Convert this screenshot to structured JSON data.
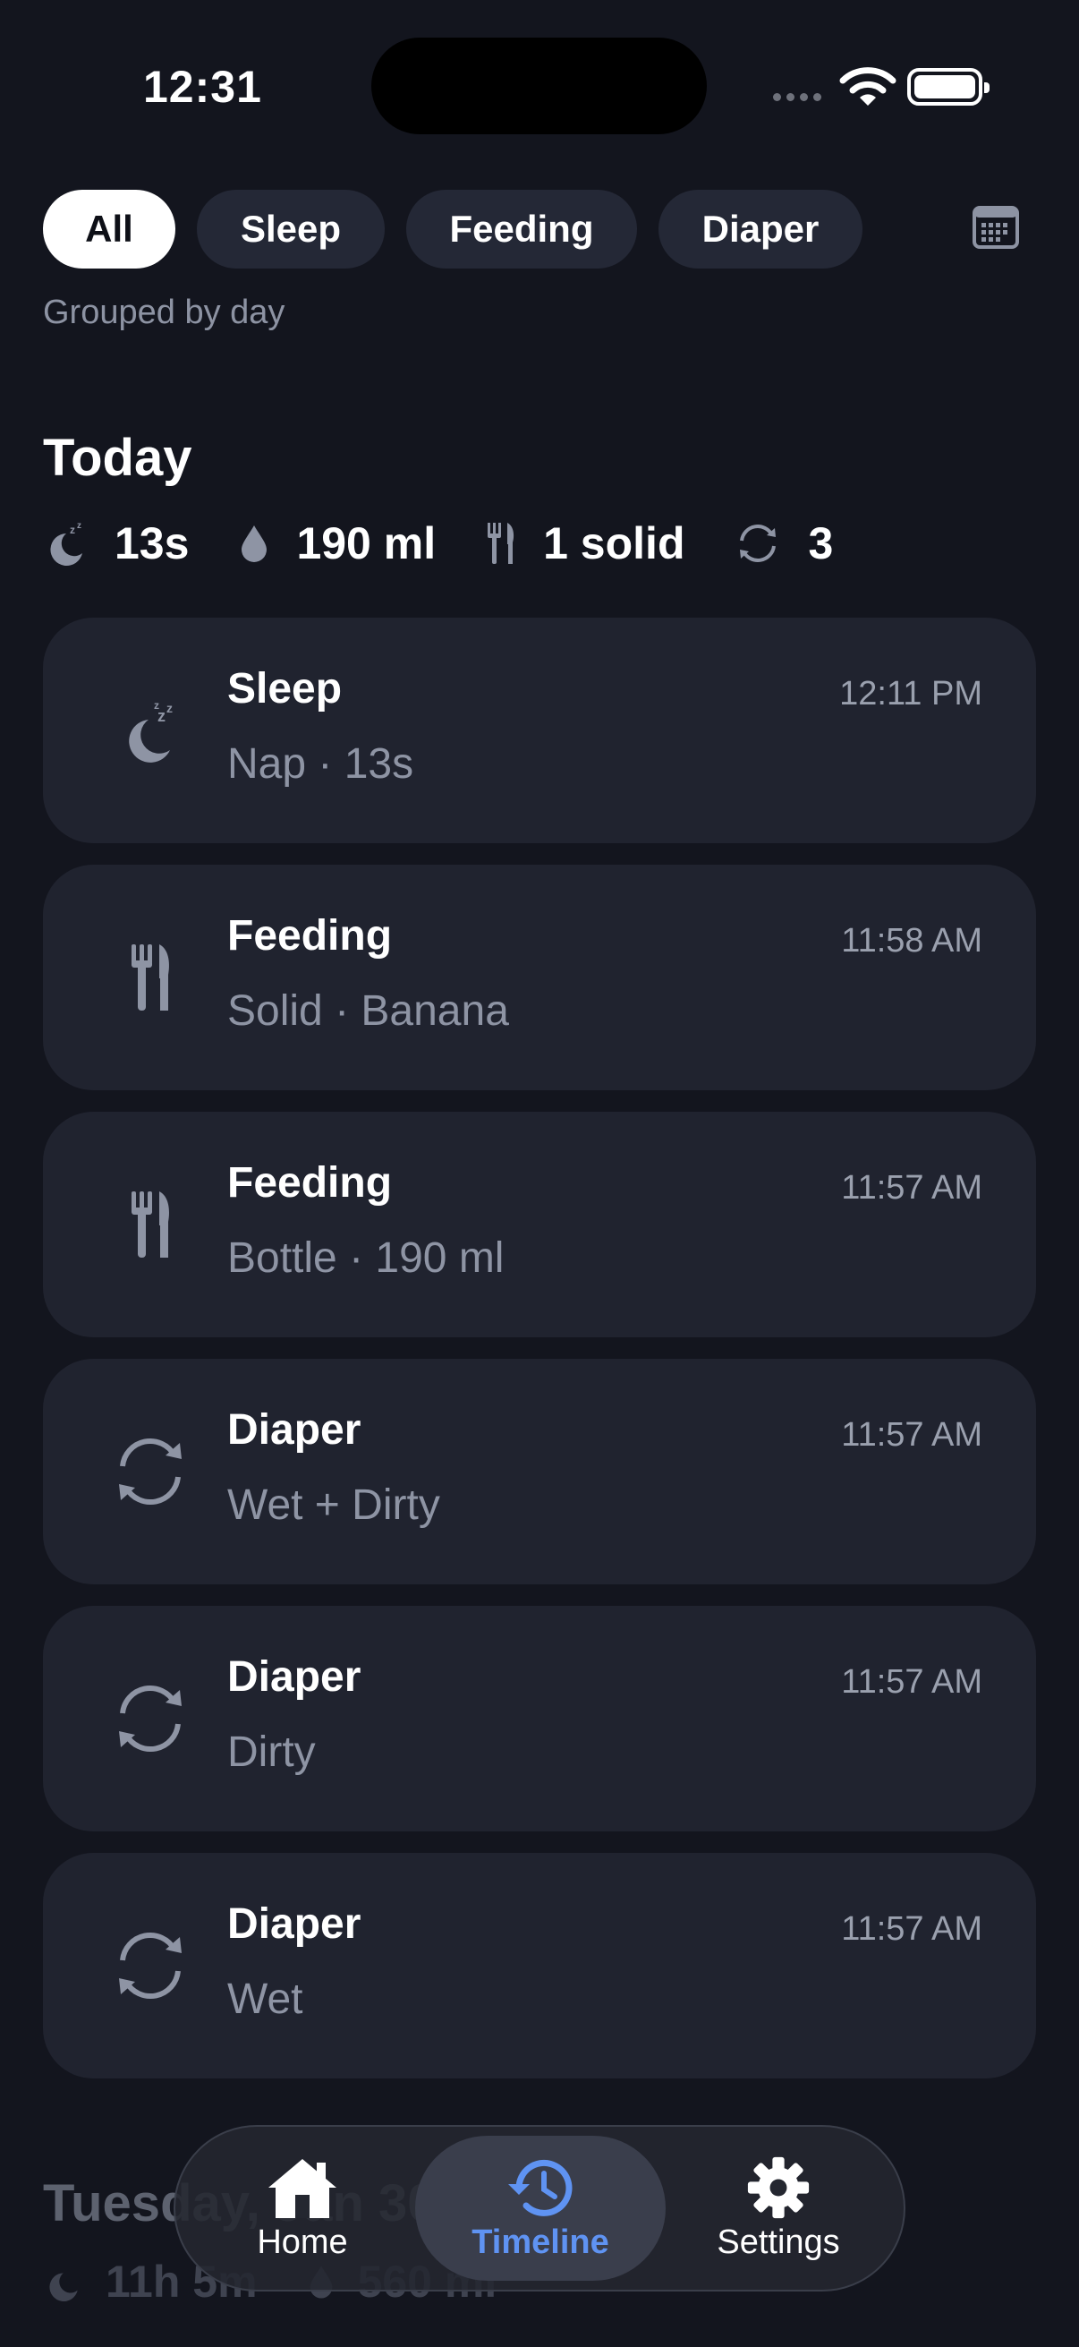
{
  "status_bar": {
    "time": "12:31"
  },
  "filters": {
    "items": [
      {
        "label": "All",
        "active": true
      },
      {
        "label": "Sleep",
        "active": false
      },
      {
        "label": "Feeding",
        "active": false
      },
      {
        "label": "Diaper",
        "active": false
      }
    ],
    "calendar_icon": "calendar-icon",
    "grouping_label": "Grouped by day"
  },
  "today": {
    "heading": "Today",
    "summary": [
      {
        "icon": "moon-sleep-icon",
        "value": "13s"
      },
      {
        "icon": "drop-icon",
        "value": "190 ml"
      },
      {
        "icon": "fork-knife-icon",
        "value": "1 solid"
      },
      {
        "icon": "cycle-icon",
        "value": "3"
      }
    ],
    "entries": [
      {
        "icon": "moon-sleep-icon",
        "title": "Sleep",
        "subtitle": "Nap · 13s",
        "time": "12:11 PM"
      },
      {
        "icon": "fork-knife-icon",
        "title": "Feeding",
        "subtitle": "Solid · Banana",
        "time": "11:58 AM"
      },
      {
        "icon": "fork-knife-icon",
        "title": "Feeding",
        "subtitle": "Bottle · 190 ml",
        "time": "11:57 AM"
      },
      {
        "icon": "cycle-icon",
        "title": "Diaper",
        "subtitle": "Wet + Dirty",
        "time": "11:57 AM"
      },
      {
        "icon": "cycle-icon",
        "title": "Diaper",
        "subtitle": "Dirty",
        "time": "11:57 AM"
      },
      {
        "icon": "cycle-icon",
        "title": "Diaper",
        "subtitle": "Wet",
        "time": "11:57 AM"
      }
    ]
  },
  "next_day": {
    "heading": "Tuesday, Jan 30",
    "summary": [
      {
        "icon": "moon-sleep-icon",
        "value": "11h 5m"
      },
      {
        "icon": "drop-icon",
        "value": "560 ml"
      }
    ]
  },
  "tab_bar": {
    "tabs": [
      {
        "label": "Home",
        "icon": "house-icon",
        "active": false
      },
      {
        "label": "Timeline",
        "icon": "history-clock-icon",
        "active": true
      },
      {
        "label": "Settings",
        "icon": "gear-icon",
        "active": false
      }
    ]
  },
  "colors": {
    "background": "#13151e",
    "card": "#20232f",
    "accent": "#5f93f2",
    "muted": "#8e94a4"
  }
}
